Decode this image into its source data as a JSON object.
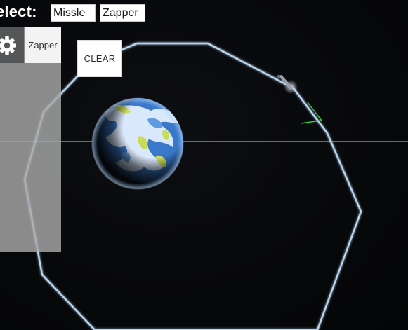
{
  "toolbar": {
    "select_label": "elect:",
    "weapons": [
      "Missle",
      "Zapper"
    ]
  },
  "side_panel": {
    "gear_icon": "gear-icon",
    "zapper_label": "Zapper"
  },
  "controls": {
    "clear_label": "CLEAR"
  },
  "colors": {
    "background": "#07080b",
    "orbit_line": "#b9d6f0",
    "horizon_line": "#c8ccd2",
    "planet_ocean": "#3a78c9",
    "planet_cloud": "#e8f2ff",
    "planet_land": "#c9dc5a",
    "trajectory": "#33d13a",
    "panel": "#a8a8a8"
  }
}
